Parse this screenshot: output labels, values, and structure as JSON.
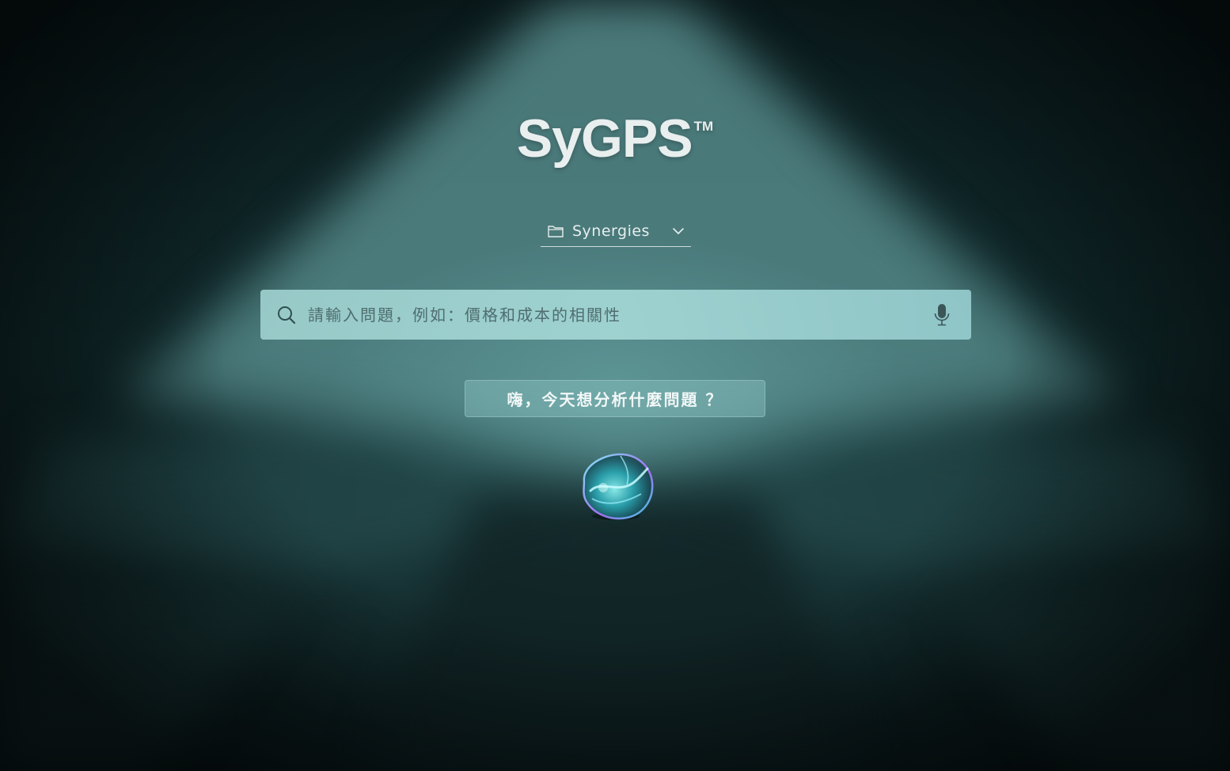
{
  "brand": {
    "name": "SyGPS",
    "trademark": "TM"
  },
  "project_selector": {
    "icon": "folder-icon",
    "selected": "Synergies",
    "dropdown_icon": "chevron-down-icon"
  },
  "search": {
    "icon": "search-icon",
    "placeholder": "請輸入問題，例如：價格和成本的相關性",
    "value": "",
    "mic_icon": "microphone-icon"
  },
  "prompt_hint": {
    "text": "嗨，今天想分析什麼問題 ？"
  },
  "assistant": {
    "icon": "ai-orb-icon"
  },
  "colors": {
    "background": "#0f2527",
    "beam": "#6fb0b0",
    "search_bg": "#a0d4d2",
    "text_light": "#e9eeee"
  }
}
